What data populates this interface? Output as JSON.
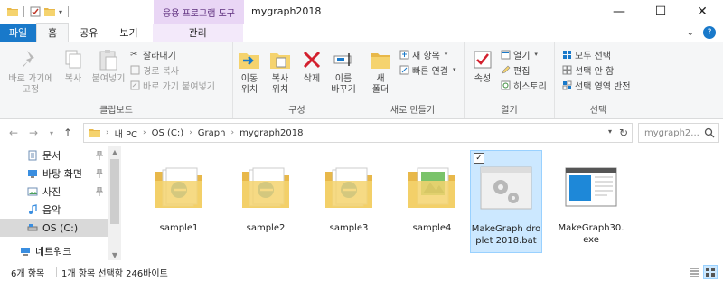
{
  "window": {
    "title": "mygraph2018",
    "context_tab_header": "응용 프로그램 도구"
  },
  "tabs": {
    "file": "파일",
    "home": "홈",
    "share": "공유",
    "view": "보기",
    "manage": "관리"
  },
  "ribbon": {
    "clipboard": {
      "label": "클립보드",
      "pin": "바로 가기에\n고정",
      "copy": "복사",
      "paste": "붙여넣기",
      "cut": "잘라내기",
      "copy_path": "경로 복사",
      "paste_shortcut": "바로 가기 붙여넣기"
    },
    "organize": {
      "label": "구성",
      "move_to": "이동\n위치",
      "copy_to": "복사\n위치",
      "delete": "삭제",
      "rename": "이름\n바꾸기"
    },
    "new": {
      "label": "새로 만들기",
      "new_folder": "새\n폴더",
      "new_item": "새 항목",
      "easy_access": "빠른 연결"
    },
    "open": {
      "label": "열기",
      "properties": "속성",
      "open": "열기",
      "edit": "편집",
      "history": "히스토리"
    },
    "select": {
      "label": "선택",
      "select_all": "모두 선택",
      "select_none": "선택 안 함",
      "invert": "선택 영역 반전"
    }
  },
  "address": {
    "crumbs": [
      "내 PC",
      "OS (C:)",
      "Graph",
      "mygraph2018"
    ],
    "search_placeholder": "mygraph2..."
  },
  "nav": {
    "items": [
      {
        "label": "문서",
        "icon": "documents-icon"
      },
      {
        "label": "바탕 화면",
        "icon": "desktop-icon"
      },
      {
        "label": "사진",
        "icon": "pictures-icon"
      },
      {
        "label": "음악",
        "icon": "music-icon"
      },
      {
        "label": "OS (C:)",
        "icon": "drive-icon"
      },
      {
        "label": "네트워크",
        "icon": "network-icon"
      }
    ]
  },
  "files": [
    {
      "name": "sample1",
      "type": "folder"
    },
    {
      "name": "sample2",
      "type": "folder"
    },
    {
      "name": "sample3",
      "type": "folder"
    },
    {
      "name": "sample4",
      "type": "folder"
    },
    {
      "name": "MakeGraph droplet 2018.bat",
      "type": "bat",
      "selected": true
    },
    {
      "name": "MakeGraph30.exe",
      "type": "exe"
    }
  ],
  "status": {
    "count": "6개 항목",
    "selection": "1개 항목 선택함 246바이트"
  },
  "colors": {
    "accent": "#1979ca",
    "context_tab": "#e9d6f5",
    "selection_bg": "#cce8ff",
    "folder_yellow": "#f5d36e"
  }
}
